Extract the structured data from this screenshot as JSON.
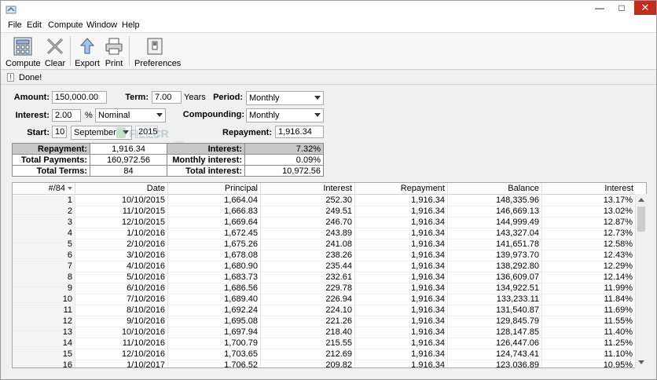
{
  "menu": [
    "File",
    "Edit",
    "Compute",
    "Window",
    "Help"
  ],
  "window_controls": {
    "minimize": "—",
    "maximize": "□",
    "close": "✕"
  },
  "toolbar": {
    "compute": "Compute",
    "clear": "Clear",
    "export": "Export",
    "print": "Print",
    "preferences": "Preferences"
  },
  "status": {
    "icon": "!",
    "text": "Done!"
  },
  "form": {
    "amount_label": "Amount:",
    "amount": "150,000.00",
    "term_label": "Term:",
    "term": "7.00",
    "term_unit": "Years",
    "period_label": "Period:",
    "period": "Monthly",
    "interest_label": "Interest:",
    "interest": "2.00",
    "interest_unit": "%",
    "interest_type": "Nominal",
    "compounding_label": "Compounding:",
    "compounding": "Monthly",
    "start_label": "Start:",
    "start_day": "10",
    "start_month": "September",
    "start_year": "2015",
    "repayment_label": "Repayment:",
    "repayment": "1,916.34"
  },
  "summary": {
    "rows": [
      {
        "l1": "Repayment:",
        "v1": "1,916.34",
        "l2": "Interest:",
        "v2": "7.32%"
      },
      {
        "l1": "Total Payments:",
        "v1": "160,972.56",
        "l2": "Monthly interest:",
        "v2": "0.09%"
      },
      {
        "l1": "Total Terms:",
        "v1": "84",
        "l2": "Total interest:",
        "v2": "10,972.56"
      }
    ]
  },
  "watermark": "FILECR",
  "watermark_sub": ".com",
  "table": {
    "headers": [
      "#/84",
      "Date",
      "Principal",
      "Interest",
      "Repayment",
      "Balance",
      "Interest"
    ],
    "rows": [
      [
        "1",
        "10/10/2015",
        "1,664.04",
        "252.30",
        "1,916.34",
        "148,335.96",
        "13.17%"
      ],
      [
        "2",
        "11/10/2015",
        "1,666.83",
        "249.51",
        "1,916.34",
        "146,669.13",
        "13.02%"
      ],
      [
        "3",
        "12/10/2015",
        "1,669.64",
        "246.70",
        "1,916.34",
        "144,999.49",
        "12.87%"
      ],
      [
        "4",
        "1/10/2016",
        "1,672.45",
        "243.89",
        "1,916.34",
        "143,327.04",
        "12.73%"
      ],
      [
        "5",
        "2/10/2016",
        "1,675.26",
        "241.08",
        "1,916.34",
        "141,651.78",
        "12.58%"
      ],
      [
        "6",
        "3/10/2016",
        "1,678.08",
        "238.26",
        "1,916.34",
        "139,973.70",
        "12.43%"
      ],
      [
        "7",
        "4/10/2016",
        "1,680.90",
        "235.44",
        "1,916.34",
        "138,292.80",
        "12.29%"
      ],
      [
        "8",
        "5/10/2016",
        "1,683.73",
        "232.61",
        "1,916.34",
        "136,609.07",
        "12.14%"
      ],
      [
        "9",
        "6/10/2016",
        "1,686.56",
        "229.78",
        "1,916.34",
        "134,922.51",
        "11.99%"
      ],
      [
        "10",
        "7/10/2016",
        "1,689.40",
        "226.94",
        "1,916.34",
        "133,233.11",
        "11.84%"
      ],
      [
        "11",
        "8/10/2016",
        "1,692.24",
        "224.10",
        "1,916.34",
        "131,540.87",
        "11.69%"
      ],
      [
        "12",
        "9/10/2016",
        "1,695.08",
        "221.26",
        "1,916.34",
        "129,845.79",
        "11.55%"
      ],
      [
        "13",
        "10/10/2016",
        "1,697.94",
        "218.40",
        "1,916.34",
        "128,147.85",
        "11.40%"
      ],
      [
        "14",
        "11/10/2016",
        "1,700.79",
        "215.55",
        "1,916.34",
        "126,447.06",
        "11.25%"
      ],
      [
        "15",
        "12/10/2016",
        "1,703.65",
        "212.69",
        "1,916.34",
        "124,743.41",
        "11.10%"
      ],
      [
        "16",
        "1/10/2017",
        "1,706.52",
        "209.82",
        "1,916.34",
        "123,036.89",
        "10.95%"
      ]
    ]
  }
}
